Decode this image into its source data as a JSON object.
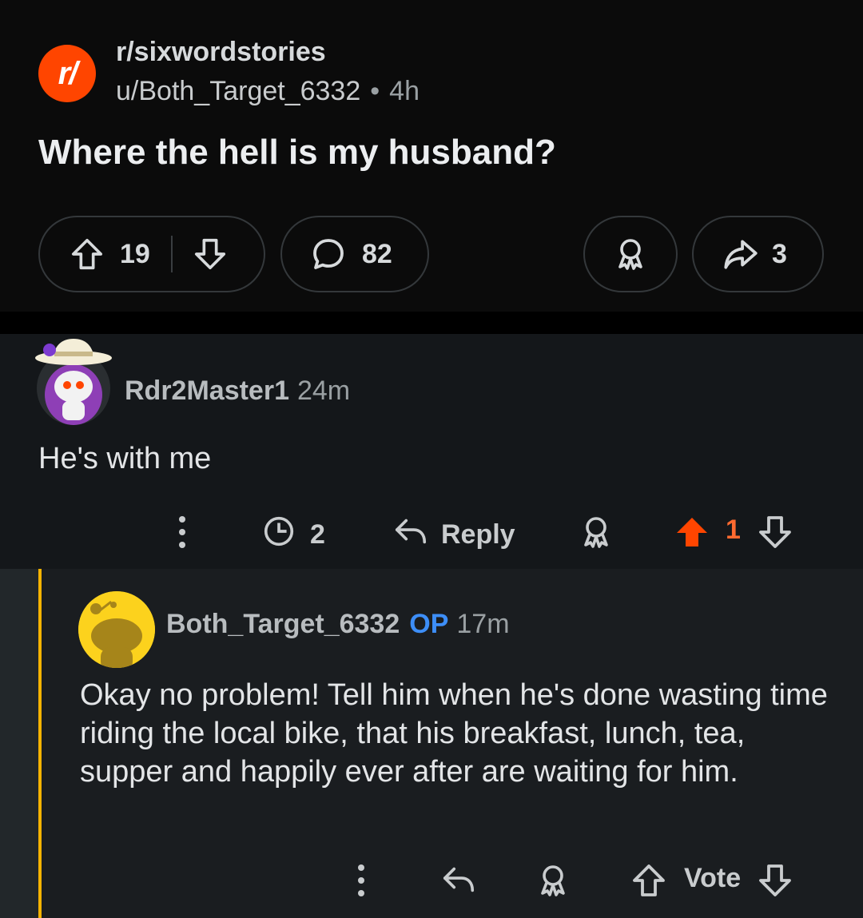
{
  "post": {
    "subreddit": "r/sixwordstories",
    "subreddit_icon_text": "r/",
    "author": "u/Both_Target_6332",
    "separator": "•",
    "age": "4h",
    "title": "Where the hell is my husband?",
    "upvotes": "19",
    "comments": "82",
    "shares": "3"
  },
  "comment1": {
    "author": "Rdr2Master1",
    "age": "24m",
    "body": "He's with me",
    "awards": "2",
    "reply_label": "Reply",
    "votes": "1",
    "upvoted": true,
    "upvote_color": "#ff4500"
  },
  "comment2": {
    "author": "Both_Target_6332",
    "op_tag": "OP",
    "age": "17m",
    "body": "Okay no problem! Tell him when he's done wasting time riding the local bike, that his breakfast, lunch, tea, supper and happily ever after are waiting for him.",
    "vote_label": "Vote",
    "thread_color": "#f5b301"
  },
  "colors": {
    "brand": "#ff4500",
    "op_blue": "#3d8ef7"
  }
}
